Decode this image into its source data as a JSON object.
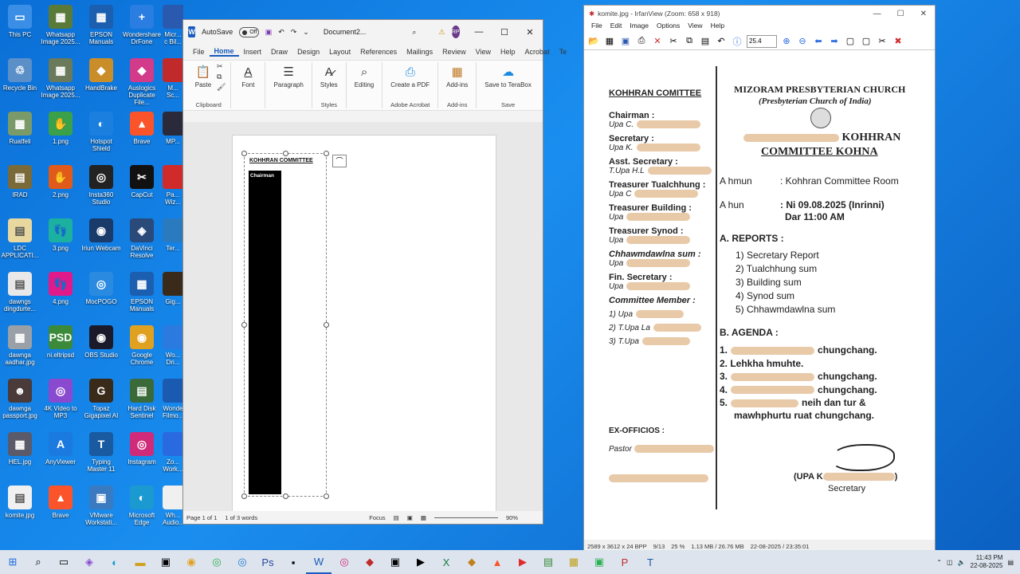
{
  "desktop": {
    "icons": [
      {
        "label": "This PC",
        "color": "#3a8ee6",
        "glyph": "▭"
      },
      {
        "label": "Whatsapp Image 2025...",
        "color": "#5a7a3a",
        "glyph": "▦"
      },
      {
        "label": "EPSON Manuals",
        "color": "#1c5fb0",
        "glyph": "▦"
      },
      {
        "label": "Wondershare DrFone",
        "color": "#2a7de1",
        "glyph": "+"
      },
      {
        "label": "Recycle Bin",
        "color": "#5a8fc8",
        "glyph": "♲"
      },
      {
        "label": "Whatsapp Image 2025...",
        "color": "#6a7a5a",
        "glyph": "▦"
      },
      {
        "label": "HandBrake",
        "color": "#c98d2a",
        "glyph": "◆"
      },
      {
        "label": "Auslogics Duplicate File...",
        "color": "#d23a8a",
        "glyph": "◆"
      },
      {
        "label": "Ruatfeli",
        "color": "#7a9a6a",
        "glyph": "▦"
      },
      {
        "label": "1.png",
        "color": "#3aa04a",
        "glyph": "✋"
      },
      {
        "label": "Hotspot Shield",
        "color": "#1b7fe0",
        "glyph": "◐"
      },
      {
        "label": "Brave",
        "color": "#fb542b",
        "glyph": "▲"
      },
      {
        "label": "IRAD",
        "color": "#7a6a3a",
        "glyph": "▤"
      },
      {
        "label": "2.png",
        "color": "#e05a1a",
        "glyph": "✋"
      },
      {
        "label": "Insta360 Studio",
        "color": "#222222",
        "glyph": "◎"
      },
      {
        "label": "CapCut",
        "color": "#111111",
        "glyph": "✂"
      },
      {
        "label": "LDC APPLICATI...",
        "color": "#e8d8a0",
        "glyph": "▤"
      },
      {
        "label": "3.png",
        "color": "#1bb0a0",
        "glyph": "👣"
      },
      {
        "label": "Iriun Webcam",
        "color": "#1a3a6a",
        "glyph": "◉"
      },
      {
        "label": "DaVinci Resolve",
        "color": "#2a4a7a",
        "glyph": "◈"
      },
      {
        "label": "dawngs dingdurte...",
        "color": "#e8e8e8",
        "glyph": "▤"
      },
      {
        "label": "4.png",
        "color": "#e01a8a",
        "glyph": "👣"
      },
      {
        "label": "MocPOGO",
        "color": "#2a8ae0",
        "glyph": "◎"
      },
      {
        "label": "EPSON Manuals",
        "color": "#1c5fb0",
        "glyph": "▦"
      },
      {
        "label": "dawnga aadhar.jpg",
        "color": "#9aa0a8",
        "glyph": "▦"
      },
      {
        "label": "ni.eltripsd",
        "color": "#3a8a3a",
        "glyph": "PSD"
      },
      {
        "label": "OBS Studio",
        "color": "#1a1a2a",
        "glyph": "◉"
      },
      {
        "label": "Google Chrome",
        "color": "#e0a020",
        "glyph": "◉"
      },
      {
        "label": "dawnga passport.jpg",
        "color": "#4a3a3a",
        "glyph": "☻"
      },
      {
        "label": "4K Video to MP3",
        "color": "#8a4ad0",
        "glyph": "◎"
      },
      {
        "label": "Topaz Gigapixel AI",
        "color": "#3a2a1a",
        "glyph": "G"
      },
      {
        "label": "Hard Disk Sentinel",
        "color": "#3a6a3a",
        "glyph": "▤"
      },
      {
        "label": "HEL.jpg",
        "color": "#5a5a6a",
        "glyph": "▦"
      },
      {
        "label": "AnyViewer",
        "color": "#1a7ae0",
        "glyph": "A"
      },
      {
        "label": "Typing Master 11",
        "color": "#1a5aa0",
        "glyph": "T"
      },
      {
        "label": "Instagram",
        "color": "#d02a7a",
        "glyph": "◎"
      },
      {
        "label": "komite.jpg",
        "color": "#f0f0f0",
        "glyph": "▤"
      },
      {
        "label": "Brave",
        "color": "#fb542b",
        "glyph": "▲"
      },
      {
        "label": "VMware Workstati...",
        "color": "#3a7ac0",
        "glyph": "▣"
      },
      {
        "label": "Microsoft Edge",
        "color": "#1a9ad0",
        "glyph": "◐"
      }
    ],
    "col5": [
      {
        "label": "Micr... c Bil...",
        "color": "#2a5ab0"
      },
      {
        "label": "M... Sc...",
        "color": "#c02a2a"
      },
      {
        "label": "MP...",
        "color": "#2a2a3a"
      },
      {
        "label": "Pa... Wiz...",
        "color": "#d02a2a"
      },
      {
        "label": "Ter...",
        "color": "#2a7ac0"
      },
      {
        "label": "Gig...",
        "color": "#3a2a1a"
      },
      {
        "label": "Wo... Dri...",
        "color": "#2a7ae0"
      },
      {
        "label": "Wonde Filmo...",
        "color": "#1a5ab0"
      },
      {
        "label": "Zo... Work...",
        "color": "#2a6ae0"
      },
      {
        "label": "Wh... Audio...",
        "color": "#f0f0f0"
      }
    ]
  },
  "word": {
    "autosave_label": "AutoSave",
    "toggle_label": "Off",
    "doc_title": "Document2...",
    "user_initials": "RP",
    "tabs": [
      "File",
      "Home",
      "Insert",
      "Draw",
      "Design",
      "Layout",
      "References",
      "Mailings",
      "Review",
      "View",
      "Help",
      "Acrobat",
      "Te"
    ],
    "active_tab": "Home",
    "ribbon": {
      "paste": "Paste",
      "font": "Font",
      "paragraph": "Paragraph",
      "styles": "Styles",
      "editing": "Editing",
      "create_pdf": "Create a PDF",
      "addins": "Add-ins",
      "save_terabox": "Save to TeraBox",
      "group_clipboard": "Clipboard",
      "group_styles": "Styles",
      "group_acrobat": "Adobe Acrobat",
      "group_addins": "Add-ins",
      "group_save": "Save"
    },
    "textbox_title": "KOHHRAN COMMITTEE",
    "bar_label": "Chairman",
    "status": {
      "page": "Page 1 of 1",
      "words": "1 of 3 words",
      "focus": "Focus",
      "zoom": "90%"
    }
  },
  "irfan": {
    "title": "komite.jpg - IrfanView (Zoom: 658 x 918)",
    "menu": [
      "File",
      "Edit",
      "Image",
      "Options",
      "View",
      "Help"
    ],
    "zoom_value": "25.4",
    "doc": {
      "left_heading": "KOHHRAN COMITTEE",
      "roles": [
        {
          "role": "Chairman :",
          "name": "Upa C."
        },
        {
          "role": "Secretary :",
          "name": "Upa K."
        },
        {
          "role": "Asst. Secretary :",
          "name": "T.Upa H.L"
        },
        {
          "role": "Treasurer Tualchhung :",
          "name": "Upa C"
        },
        {
          "role": "Treasurer Building :",
          "name": "Upa"
        },
        {
          "role": "Treasurer Synod :",
          "name": "Upa"
        },
        {
          "role": "Chhawmdawlna sum :",
          "name": "Upa"
        },
        {
          "role": "Fin. Secretary :",
          "name": "Upa"
        }
      ],
      "member_heading": "Committee Member :",
      "members": [
        "1) Upa",
        "2) T.Upa La",
        "3) T.Upa"
      ],
      "exofficio": "EX-OFFICIOS :",
      "pastor": "Pastor",
      "church_name": "MIZORAM PRESBYTERIAN CHURCH",
      "church_sub": "(Presbyterian Church of India)",
      "committee_title1": "KOHHRAN",
      "committee_title2": "COMMITTEE KOHNA",
      "ahmun_label": "A hmun",
      "ahmun_val": ": Kohhran Committee Room",
      "ahun_label": "A hun",
      "ahun_val": ": Ni 09.08.2025 (Inrinni)",
      "ahun_time": "Dar 11:00 AM",
      "reports_heading": "A.  REPORTS :",
      "reports": [
        "1)  Secretary Report",
        "2)  Tualchhung sum",
        "3)  Building sum",
        "4)  Synod sum",
        "5)  Chhawmdawlna sum"
      ],
      "agenda_heading": "B.   AGENDA :",
      "agenda": [
        "1.",
        "2.  Lehkha hmuhte.",
        "3.",
        "4.",
        "5."
      ],
      "agenda_tail": [
        "chungchang.",
        "",
        "chungchang.",
        "chungchang.",
        "neih dan tur &"
      ],
      "agenda_last": "mawhphurtu ruat chungchang.",
      "sign_prefix": "(UPA K",
      "sign_suffix": ")",
      "sign_title": "Secretary"
    },
    "status": [
      "2589 x 3612 x 24 BPP",
      "9/13",
      "25 %",
      "1.13 MB / 26.76 MB",
      "22-08-2025 / 23:35:01"
    ]
  },
  "taskbar": {
    "time": "11:43 PM",
    "date": "22-08-2025"
  }
}
